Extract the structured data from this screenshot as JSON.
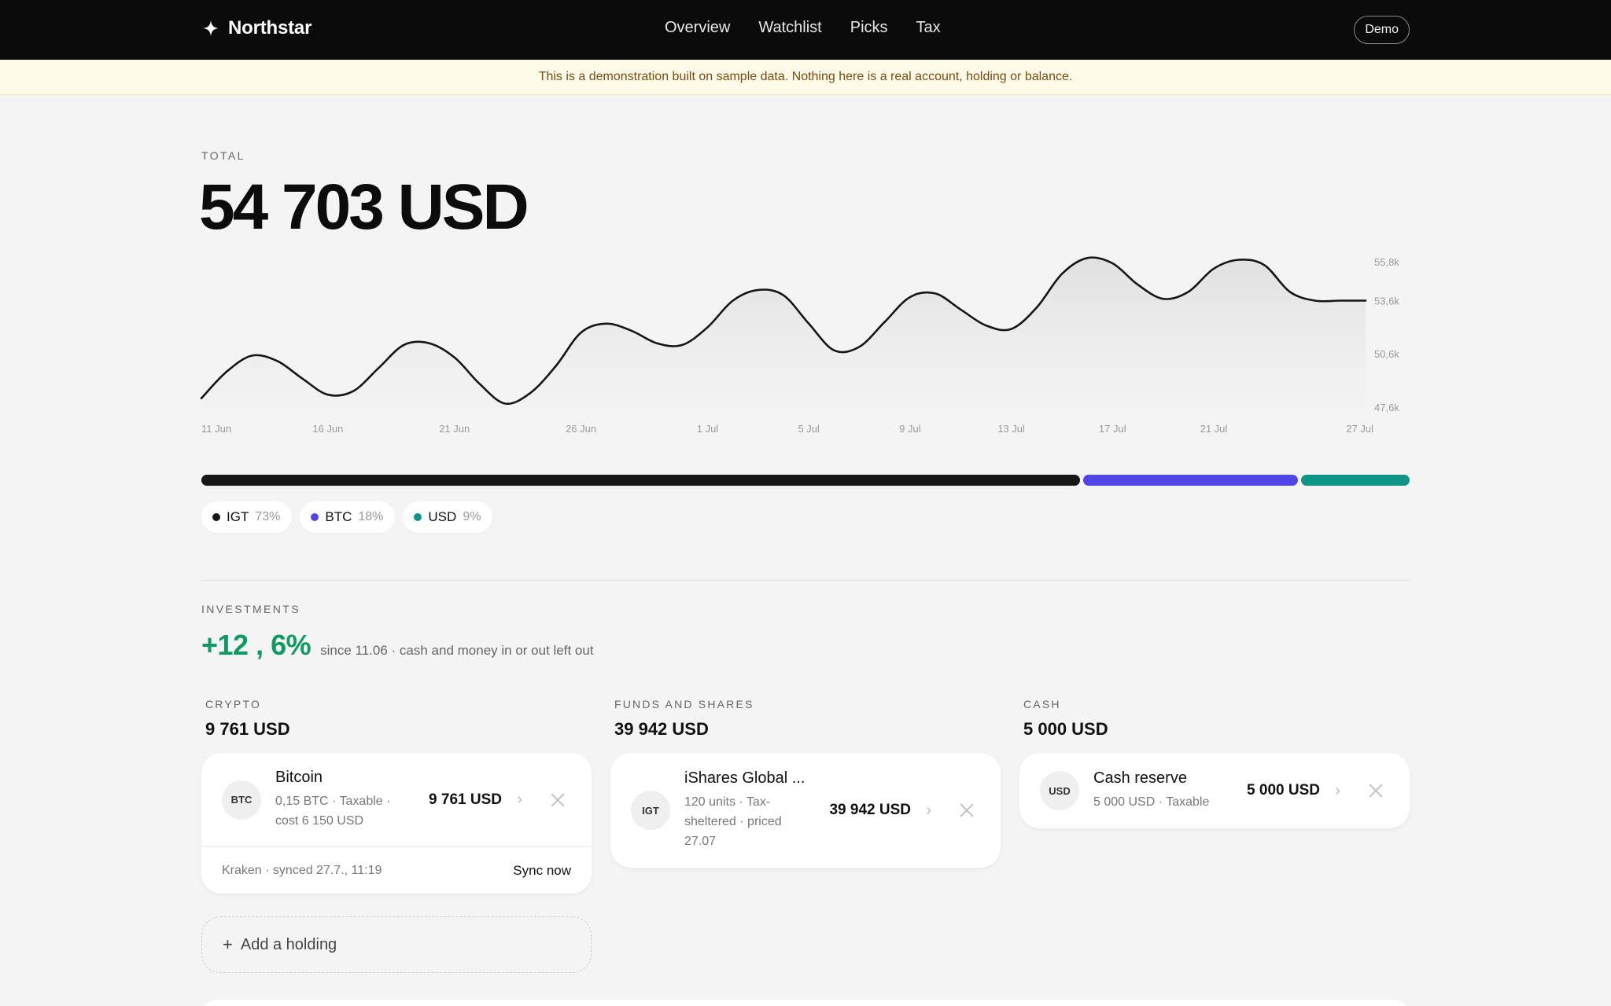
{
  "app": {
    "name": "Northstar"
  },
  "nav": [
    "Overview",
    "Watchlist",
    "Picks",
    "Tax"
  ],
  "mode_badge": "Demo",
  "notice": "This is a demonstration built on sample data. Nothing here is a real account, holding or balance.",
  "total": {
    "label": "TOTAL",
    "value": "54 703 USD"
  },
  "chart_data": {
    "type": "area",
    "x": [
      "11 Jun",
      "12 Jun",
      "13 Jun",
      "14 Jun",
      "15 Jun",
      "16 Jun",
      "17 Jun",
      "18 Jun",
      "19 Jun",
      "20 Jun",
      "21 Jun",
      "22 Jun",
      "23 Jun",
      "24 Jun",
      "25 Jun",
      "26 Jun",
      "27 Jun",
      "28 Jun",
      "29 Jun",
      "30 Jun",
      "1 Jul",
      "2 Jul",
      "3 Jul",
      "4 Jul",
      "5 Jul",
      "6 Jul",
      "7 Jul",
      "8 Jul",
      "9 Jul",
      "10 Jul",
      "11 Jul",
      "12 Jul",
      "13 Jul",
      "14 Jul",
      "15 Jul",
      "16 Jul",
      "17 Jul",
      "18 Jul",
      "19 Jul",
      "20 Jul",
      "21 Jul",
      "22 Jul",
      "23 Jul",
      "24 Jul",
      "25 Jul",
      "26 Jul",
      "27 Jul"
    ],
    "values": [
      48100,
      49600,
      50500,
      50200,
      49200,
      48300,
      48500,
      49800,
      51100,
      51200,
      50400,
      48900,
      47800,
      48400,
      49900,
      51800,
      52300,
      51900,
      51200,
      51100,
      52100,
      53600,
      54200,
      53900,
      52300,
      50800,
      51000,
      52400,
      53800,
      54000,
      53100,
      52200,
      52000,
      53200,
      55100,
      56000,
      55700,
      54500,
      53700,
      54100,
      55400,
      55900,
      55600,
      54100,
      53600,
      53600,
      53600
    ],
    "xticks": [
      "11 Jun",
      "16 Jun",
      "21 Jun",
      "26 Jun",
      "1 Jul",
      "5 Jul",
      "9 Jul",
      "13 Jul",
      "17 Jul",
      "21 Jul",
      "27 Jul"
    ],
    "yticks": [
      "55,8k",
      "53,6k",
      "50,6k",
      "47,6k"
    ],
    "ylim": [
      47600,
      56100
    ],
    "title": "",
    "xlabel": "",
    "ylabel": "",
    "line_color": "#151515",
    "grid": false
  },
  "allocation": [
    {
      "ticker": "IGT",
      "pct": "73%",
      "share": 0.73,
      "color": "#161616"
    },
    {
      "ticker": "BTC",
      "pct": "18%",
      "share": 0.18,
      "color": "#4f46e5"
    },
    {
      "ticker": "USD",
      "pct": "9%",
      "share": 0.09,
      "color": "#0f9488"
    }
  ],
  "investments": {
    "label": "INVESTMENTS",
    "change": "+12 , 6%",
    "note": "since 11.06 · cash and money in or out left out"
  },
  "columns": [
    {
      "label": "CRYPTO",
      "total": "9 761 USD",
      "holding": {
        "ticker": "BTC",
        "name": "Bitcoin",
        "meta": "0,15 BTC · Taxable · cost 6 150 USD",
        "value": "9 761 USD",
        "sync_text": "Kraken · synced 27.7., 11:19",
        "sync_action": "Sync now"
      }
    },
    {
      "label": "FUNDS AND SHARES",
      "total": "39 942 USD",
      "holding": {
        "ticker": "IGT",
        "name": "iShares Global ...",
        "meta": "120 units · Tax-sheltered · priced 27.07",
        "value": "39 942 USD"
      }
    },
    {
      "label": "CASH",
      "total": "5 000 USD",
      "holding": {
        "ticker": "USD",
        "name": "Cash reserve",
        "meta": "5 000 USD · Taxable",
        "value": "5 000 USD"
      }
    }
  ],
  "add_holding": {
    "icon": "plus-icon",
    "label": "Add a holding"
  },
  "icons": {
    "brand": "sparkle-icon",
    "chevron": "chevron-right-icon",
    "remove": "close-icon"
  }
}
